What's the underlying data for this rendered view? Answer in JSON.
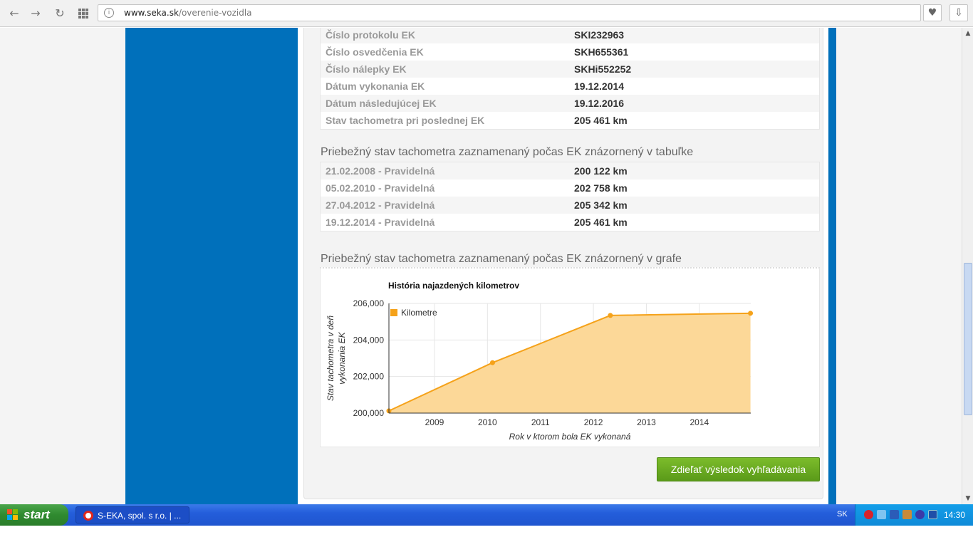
{
  "browser": {
    "url_domain": "www.seka.sk",
    "url_path": "/overenie-vozidla"
  },
  "ek_details": [
    {
      "label": "Číslo protokolu EK",
      "value": "SKI232963"
    },
    {
      "label": "Číslo osvedčenia EK",
      "value": "SKH655361"
    },
    {
      "label": "Číslo nálepky EK",
      "value": "SKHi552252"
    },
    {
      "label": "Dátum vykonania EK",
      "value": "19.12.2014"
    },
    {
      "label": "Dátum následujúcej EK",
      "value": "19.12.2016"
    },
    {
      "label": "Stav tachometra pri poslednej EK",
      "value": "205 461 km"
    }
  ],
  "table_section": {
    "heading": "Priebežný stav tachometra zaznamenaný počas EK znázornený v tabuľke",
    "rows": [
      {
        "label": "21.02.2008 - Pravidelná",
        "value": "200 122 km"
      },
      {
        "label": "05.02.2010 - Pravidelná",
        "value": "202 758 km"
      },
      {
        "label": "27.04.2012 - Pravidelná",
        "value": "205 342 km"
      },
      {
        "label": "19.12.2014 - Pravidelná",
        "value": "205 461 km"
      }
    ]
  },
  "chart_section": {
    "heading": "Priebežný stav tachometra zaznamenaný počas EK znázornený v grafe"
  },
  "chart_data": {
    "type": "area",
    "title": "História najazdených kilometrov",
    "xlabel": "Rok v ktorom bola EK vykonaná",
    "ylabel": "Stav tachometra v deň vykonania EK",
    "legend": "top-left",
    "grid": true,
    "color": "#f5a21a",
    "fill": "#fcd898",
    "xlim": [
      2008.14,
      2014.97
    ],
    "ylim": [
      200000,
      206000
    ],
    "x_ticks": [
      "2009",
      "2010",
      "2011",
      "2012",
      "2013",
      "2014"
    ],
    "y_ticks": [
      "200,000",
      "202,000",
      "204,000",
      "206,000"
    ],
    "series": [
      {
        "name": "Kilometre",
        "x": [
          "21.02.2008",
          "05.02.2010",
          "27.04.2012",
          "19.12.2014"
        ],
        "values": [
          200122,
          202758,
          205342,
          205461
        ]
      }
    ]
  },
  "share_button": "Zdieľať výsledok vyhľadávania",
  "taskbar": {
    "start": "start",
    "task": "S-EKA, spol. s r.o. | ...",
    "lang": "SK",
    "clock": "14:30"
  }
}
